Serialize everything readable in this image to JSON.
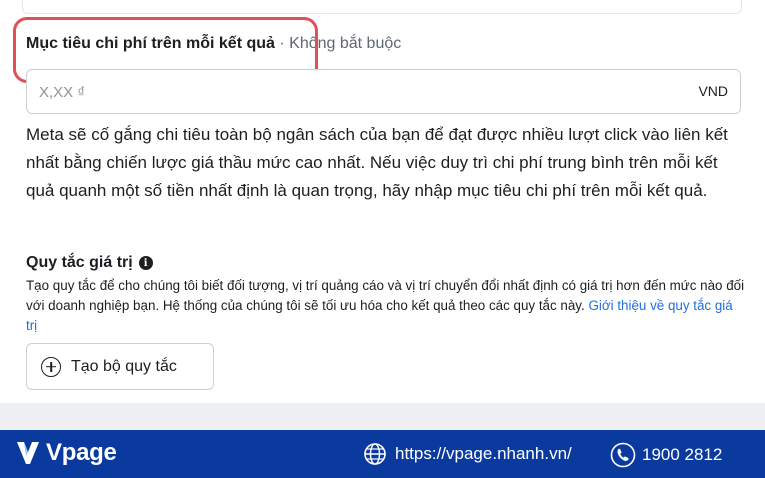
{
  "cost_goal": {
    "title": "Mục tiêu chi phí trên mỗi kết quả",
    "optional": " · Không bắt buộc",
    "placeholder": "X,XX ₫",
    "value": "",
    "currency": "VND",
    "description": "Meta sẽ cố gắng chi tiêu toàn bộ ngân sách của bạn để đạt được nhiều lượt click vào liên kết nhất bằng chiến lược giá thầu mức cao nhất. Nếu việc duy trì chi phí trung bình trên mỗi kết quả quanh một số tiền nhất định là quan trọng, hãy nhập mục tiêu chi phí trên mỗi kết quả."
  },
  "value_rules": {
    "title": "Quy tắc giá trị",
    "info_glyph": "i",
    "description": "Tạo quy tắc để cho chúng tôi biết đối tượng, vị trí quảng cáo và vị trí chuyển đổi nhất định có giá trị hơn đến mức nào đối với doanh nghiệp bạn. Hệ thống của chúng tôi sẽ tối ưu hóa cho kết quả theo các quy tắc này.",
    "link_label": "Giới thiệu về quy tắc giá trị",
    "create_button_label": "Tạo bộ quy tắc"
  },
  "footer": {
    "brand": "Vpage",
    "website": "https://vpage.nhanh.vn/",
    "phone": "1900 2812"
  },
  "colors": {
    "highlight": "#e0505a",
    "link": "#216fdb",
    "footer_bg": "#0b3a9e"
  }
}
